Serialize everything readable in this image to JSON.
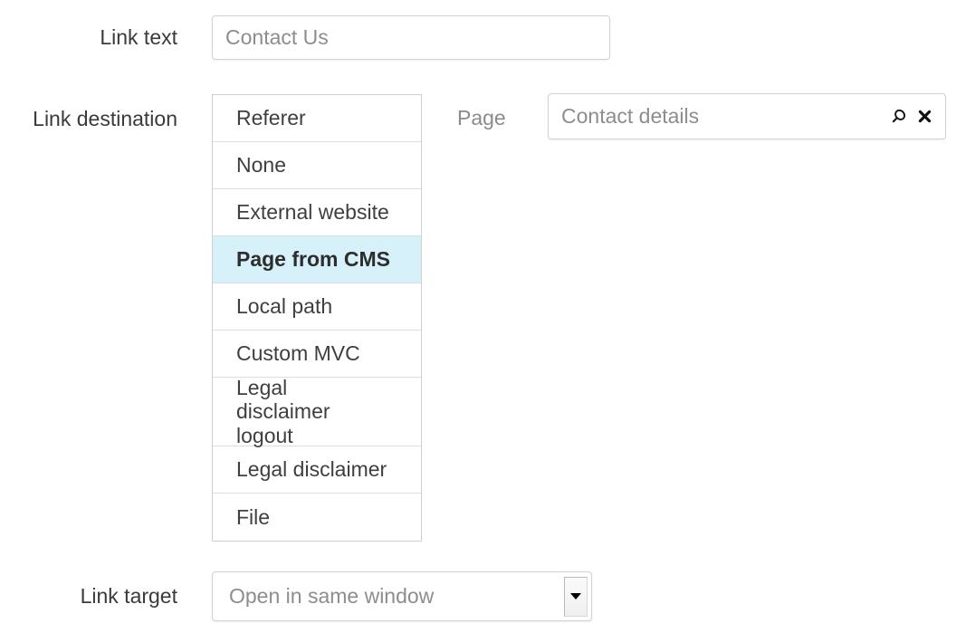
{
  "form": {
    "link_text": {
      "label": "Link text",
      "value": "Contact Us"
    },
    "link_destination": {
      "label": "Link destination",
      "options": [
        {
          "label": "Referer",
          "selected": false
        },
        {
          "label": "None",
          "selected": false
        },
        {
          "label": "External website",
          "selected": false
        },
        {
          "label": "Page from CMS",
          "selected": true
        },
        {
          "label": "Local path",
          "selected": false
        },
        {
          "label": "Custom MVC",
          "selected": false
        },
        {
          "label": "Legal disclaimer logout",
          "selected": false
        },
        {
          "label": "Legal disclaimer",
          "selected": false
        },
        {
          "label": "File",
          "selected": false
        }
      ]
    },
    "page": {
      "label": "Page",
      "value": "Contact details",
      "search_icon": "search-icon",
      "clear_icon": "clear-icon"
    },
    "link_target": {
      "label": "Link target",
      "value": "Open in same window",
      "dropdown_icon": "chevron-down-icon"
    }
  },
  "colors": {
    "selected_row_background": "#d7f1fa",
    "label_text": "#3a3a3a",
    "muted_text": "#8d8d8d",
    "border": "#d2d2d2"
  }
}
